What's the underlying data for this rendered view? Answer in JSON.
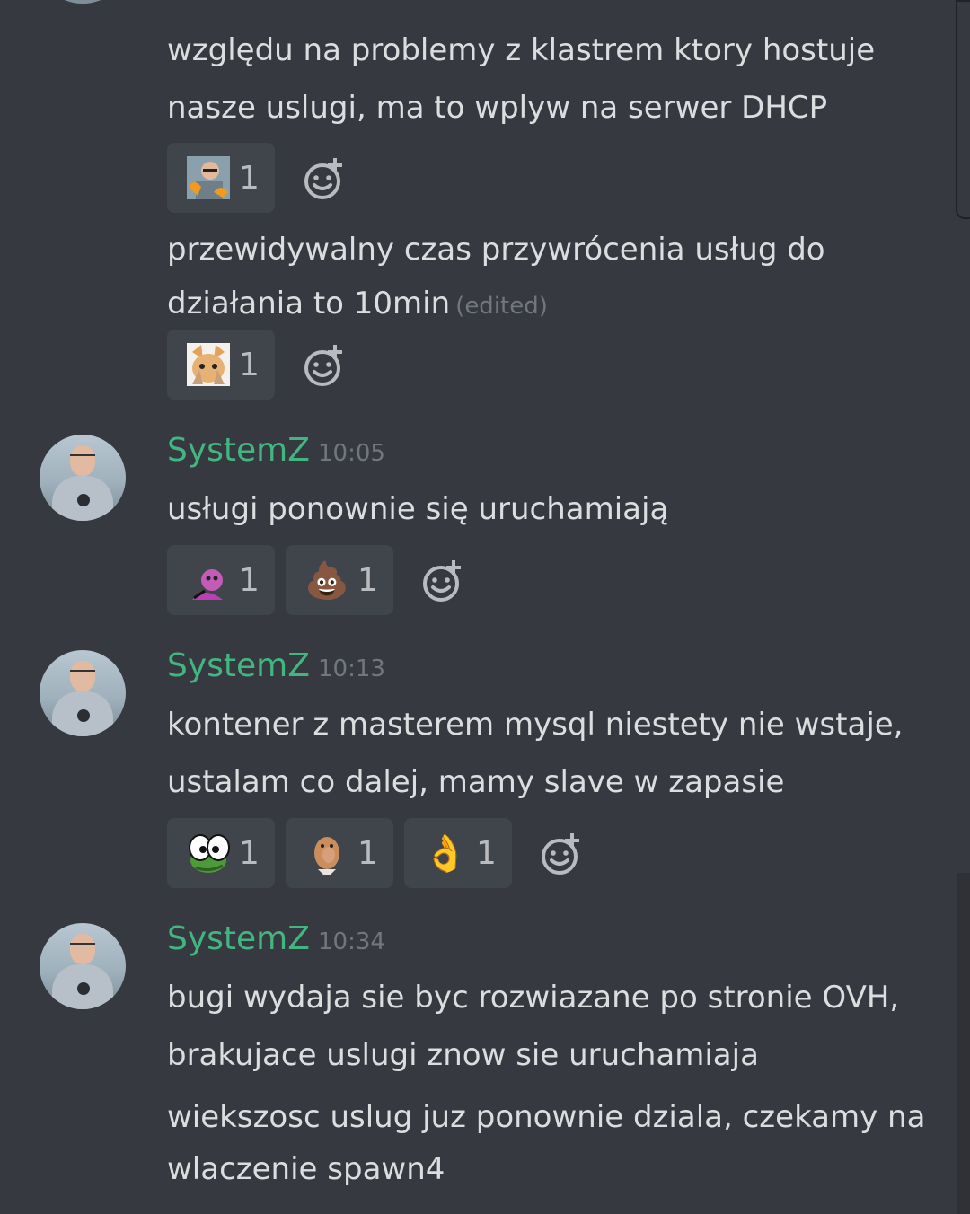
{
  "messages": {
    "m1_line1": "względu na problemy z klastrem ktory hostuje",
    "m1_line2": "nasze uslugi, ma to wplyw na serwer DHCP",
    "m1_reactions": [
      {
        "emoji_name": "custom-emoji-man-with-orange-hands",
        "count": "1"
      }
    ],
    "m2_line1": "przewidywalny czas przywrócenia usług do",
    "m2_line2": "działania to 10min",
    "m2_edited": "(edited)",
    "m2_reactions": [
      {
        "emoji_name": "custom-emoji-cat-face",
        "count": "1"
      }
    ],
    "g1": {
      "username": "SystemZ",
      "time": "10:05",
      "line1": "usługi ponownie się uruchamiają",
      "reactions": [
        {
          "emoji_name": "custom-emoji-pink-pepe",
          "count": "1"
        },
        {
          "emoji_name": "poop-emoji",
          "emoji": "💩",
          "count": "1"
        }
      ]
    },
    "g2": {
      "username": "SystemZ",
      "time": "10:13",
      "line1": "kontener z masterem mysql niestety nie wstaje,",
      "line2": "ustalam co dalej, mamy slave w zapasie",
      "reactions": [
        {
          "emoji_name": "custom-emoji-pepe-eyes",
          "count": "1"
        },
        {
          "emoji_name": "custom-emoji-monkey",
          "count": "1"
        },
        {
          "emoji_name": "ok-hand-emoji",
          "emoji": "👌",
          "count": "1"
        }
      ]
    },
    "g3": {
      "username": "SystemZ",
      "time": "10:34",
      "line1": "bugi wydaja sie byc rozwiazane po stronie OVH,",
      "line2": "brakujace uslugi znow sie uruchamiaja",
      "line3": "wiekszosc uslug juz ponownie dziala, czekamy na",
      "line4": "wlaczenie spawn4"
    }
  },
  "colors": {
    "background": "#36393f",
    "username": "#43b581",
    "reaction_bg": "#40444b",
    "muted": "#72767d"
  },
  "icons": {
    "add_reaction": "add-reaction-icon"
  }
}
